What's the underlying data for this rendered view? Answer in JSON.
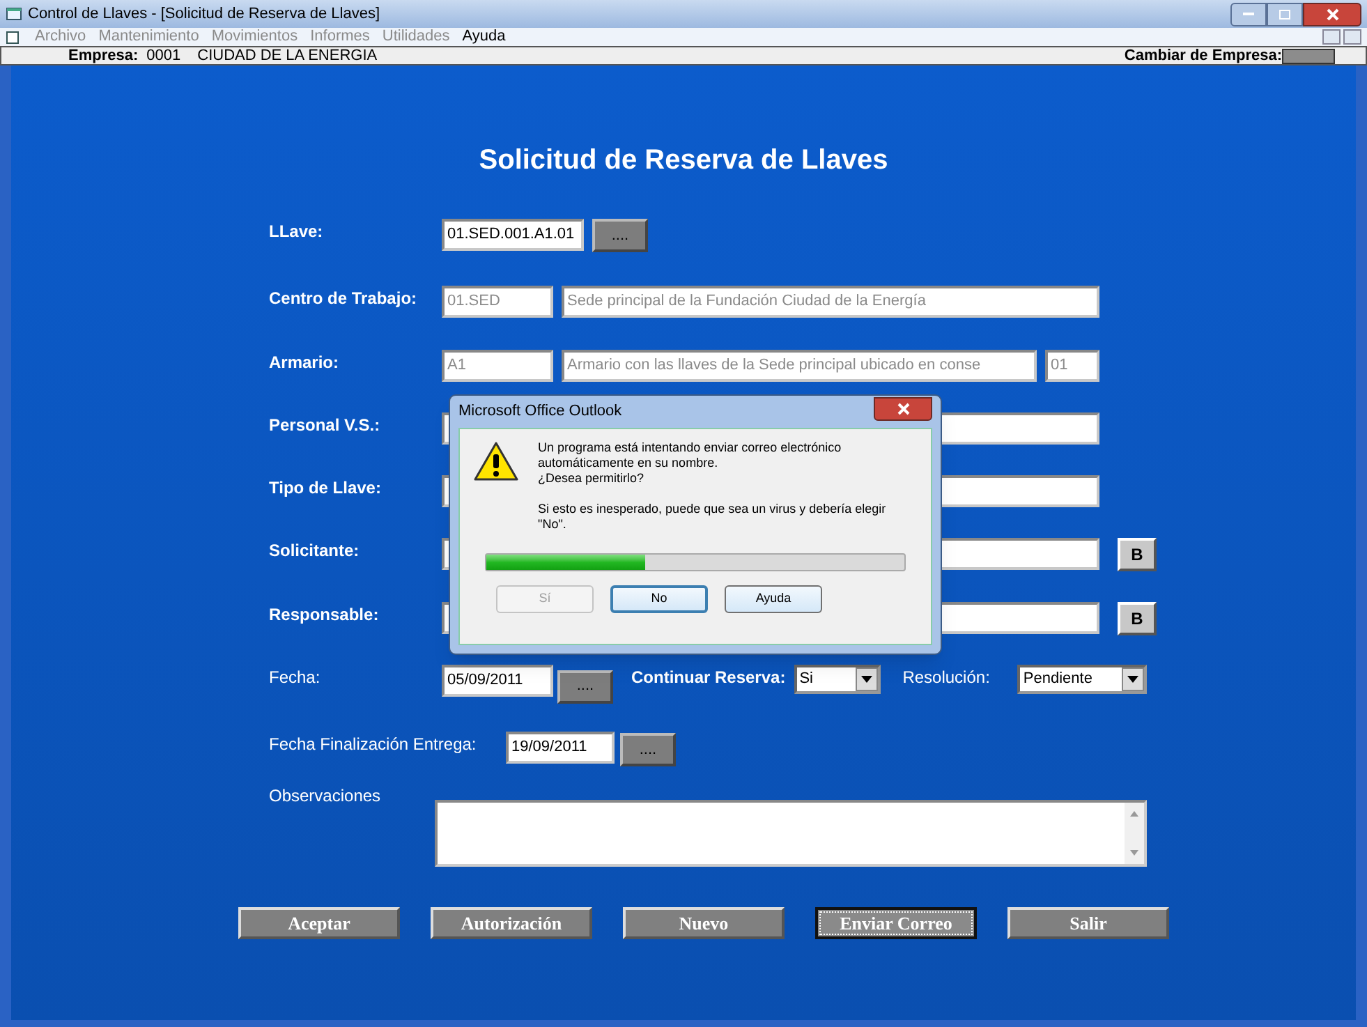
{
  "window": {
    "title": "Control de Llaves - [Solicitud de Reserva de Llaves]"
  },
  "menu": [
    {
      "label": "Archivo",
      "disabled": true
    },
    {
      "label": "Mantenimiento",
      "disabled": true
    },
    {
      "label": "Movimientos",
      "disabled": true
    },
    {
      "label": "Informes",
      "disabled": true
    },
    {
      "label": "Utilidades",
      "disabled": true
    },
    {
      "label": "Ayuda",
      "disabled": false
    }
  ],
  "company_bar": {
    "label": "Empresa:",
    "code": "0001",
    "name": "CIUDAD DE LA ENERGIA",
    "change_label": "Cambiar de Empresa:"
  },
  "form": {
    "title": "Solicitud de Reserva de Llaves",
    "llave": {
      "label": "LLave:",
      "value": "01.SED.001.A1.01",
      "button": "...."
    },
    "centro": {
      "label": "Centro de Trabajo:",
      "code": "01.SED",
      "description": "Sede principal de la Fundación Ciudad de la Energía"
    },
    "armario": {
      "label": "Armario:",
      "code": "A1",
      "description": "Armario con las llaves de la Sede principal ubicado en conse",
      "number": "01"
    },
    "personal": {
      "label": "Personal V.S.:"
    },
    "tipo": {
      "label": "Tipo de Llave:"
    },
    "solicitante": {
      "label": "Solicitante:",
      "button": "B"
    },
    "responsable": {
      "label": "Responsable:",
      "button": "B"
    },
    "fecha": {
      "label": "Fecha:",
      "value": "05/09/2011",
      "button": "....",
      "continuar_label": "Continuar Reserva:",
      "continuar_value": "Si",
      "resolucion_label": "Resolución:",
      "resolucion_value": "Pendiente"
    },
    "fecha_fin": {
      "label": "Fecha Finalización Entrega:",
      "value": "19/09/2011",
      "button": "...."
    },
    "observaciones": {
      "label": "Observaciones"
    }
  },
  "buttons": [
    {
      "label": "Aceptar",
      "focused": false
    },
    {
      "label": "Autorización",
      "focused": false
    },
    {
      "label": "Nuevo",
      "focused": false
    },
    {
      "label": "Enviar Correo",
      "focused": true
    },
    {
      "label": "Salir",
      "focused": false
    }
  ],
  "dialog": {
    "title": "Microsoft Office Outlook",
    "message": "Un programa está intentando enviar correo electrónico automáticamente en su nombre.",
    "question": "¿Desea permitirlo?",
    "warning": "Si esto es inesperado, puede que sea un virus y debería elegir \"No\".",
    "progress": {
      "level": 0.38
    },
    "buttons": [
      {
        "label": "Sí",
        "disabled": true,
        "default": false
      },
      {
        "label": "No",
        "disabled": false,
        "default": true
      },
      {
        "label": "Ayuda",
        "disabled": false,
        "default": false
      }
    ]
  }
}
